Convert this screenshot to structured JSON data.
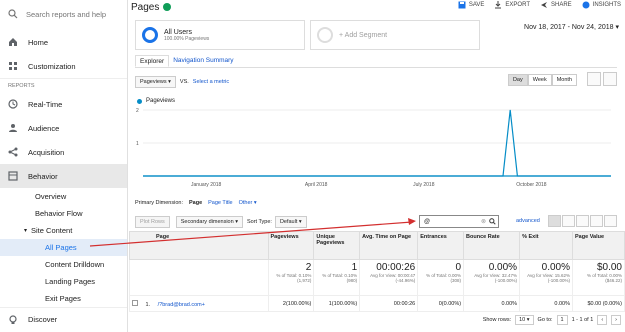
{
  "sidebar": {
    "search_placeholder": "Search reports and help",
    "items": [
      {
        "label": "Home",
        "icon": "home-icon"
      },
      {
        "label": "Customization",
        "icon": "grid-icon"
      }
    ],
    "section_reports": "REPORTS",
    "reports": [
      {
        "label": "Real-Time",
        "icon": "clock-icon"
      },
      {
        "label": "Audience",
        "icon": "person-icon"
      },
      {
        "label": "Acquisition",
        "icon": "acquisition-icon"
      },
      {
        "label": "Behavior",
        "icon": "behavior-icon"
      }
    ],
    "behavior_sub": [
      "Overview",
      "Behavior Flow"
    ],
    "site_content": "Site Content",
    "site_content_sub": [
      "All Pages",
      "Content Drilldown",
      "Landing Pages",
      "Exit Pages"
    ],
    "discover": "Discover"
  },
  "header": {
    "title": "Pages",
    "actions": [
      "SAVE",
      "EXPORT",
      "SHARE",
      "INSIGHTS"
    ]
  },
  "segments": {
    "seg1_name": "All Users",
    "seg1_sub": "100.00% Pageviews",
    "seg2": "+ Add Segment"
  },
  "date_range": "Nov 18, 2017 - Nov 24, 2018",
  "tabs": [
    "Explorer",
    "Navigation Summary"
  ],
  "metric_select": "Pageviews",
  "vs": "VS.",
  "select_metric": "Select a metric",
  "granularity": [
    "Day",
    "Week",
    "Month"
  ],
  "legend_label": "Pageviews",
  "chart_data": {
    "type": "line",
    "x_ticks": [
      "January 2018",
      "April 2018",
      "July 2018",
      "October 2018"
    ],
    "y_ticks": [
      1,
      2
    ],
    "ylim": [
      0,
      2
    ],
    "series": [
      {
        "name": "Pageviews",
        "values": [
          0,
          0,
          0,
          0,
          0,
          0,
          0,
          0,
          0,
          0,
          0,
          0,
          0,
          0,
          0,
          0,
          0,
          0,
          0,
          0,
          0,
          0,
          0,
          0,
          0,
          0,
          0,
          0,
          0,
          0,
          0,
          0,
          0,
          0,
          0,
          0,
          0,
          0,
          0,
          0,
          0,
          0,
          0,
          0,
          0,
          0,
          0,
          0,
          0,
          0,
          0,
          2,
          0,
          0,
          0,
          0,
          0,
          0,
          0,
          0,
          0,
          0,
          0,
          0,
          0,
          0
        ]
      }
    ]
  },
  "primary_dimension": {
    "label": "Primary Dimension:",
    "active": "Page",
    "options": [
      "Page Title",
      "Other"
    ]
  },
  "filter": {
    "plot_rows": "Plot Rows",
    "secondary_dimension": "Secondary dimension",
    "sort_type_label": "Sort Type:",
    "sort_type": "Default",
    "search_value": "@",
    "advanced": "advanced"
  },
  "table": {
    "headers": [
      "Page",
      "Pageviews",
      "Unique Pageviews",
      "Avg. Time on Page",
      "Entrances",
      "Bounce Rate",
      "% Exit",
      "Page Value"
    ],
    "totals": [
      {
        "big": "2",
        "small": "% of Total: 0.10% (1,972)"
      },
      {
        "big": "1",
        "small": "% of Total: 0.10% (980)"
      },
      {
        "big": "00:00:26",
        "small": "Avg for View: 00:00:47 (-44.96%)"
      },
      {
        "big": "0",
        "small": "% of Total: 0.00% (308)"
      },
      {
        "big": "0.00%",
        "small": "Avg for View: 32.47% (-100.00%)"
      },
      {
        "big": "0.00%",
        "small": "Avg for View: 15.62% (-100.00%)"
      },
      {
        "big": "$0.00",
        "small": "% of Total: 0.00% ($46.22)"
      }
    ],
    "rows": [
      {
        "num": "1.",
        "page": "/?brad@brad.com+",
        "pageviews": "2(100.00%)",
        "unique": "1(100.00%)",
        "avg_time": "00:00:26",
        "entrances": "0(0.00%)",
        "bounce": "0.00%",
        "exit": "0.00%",
        "value": "$0.00 (0.00%)"
      }
    ]
  },
  "pager": {
    "show_rows_label": "Show rows:",
    "show_rows": "10",
    "goto_label": "Go to:",
    "goto": "1",
    "range": "1 - 1 of 1"
  }
}
